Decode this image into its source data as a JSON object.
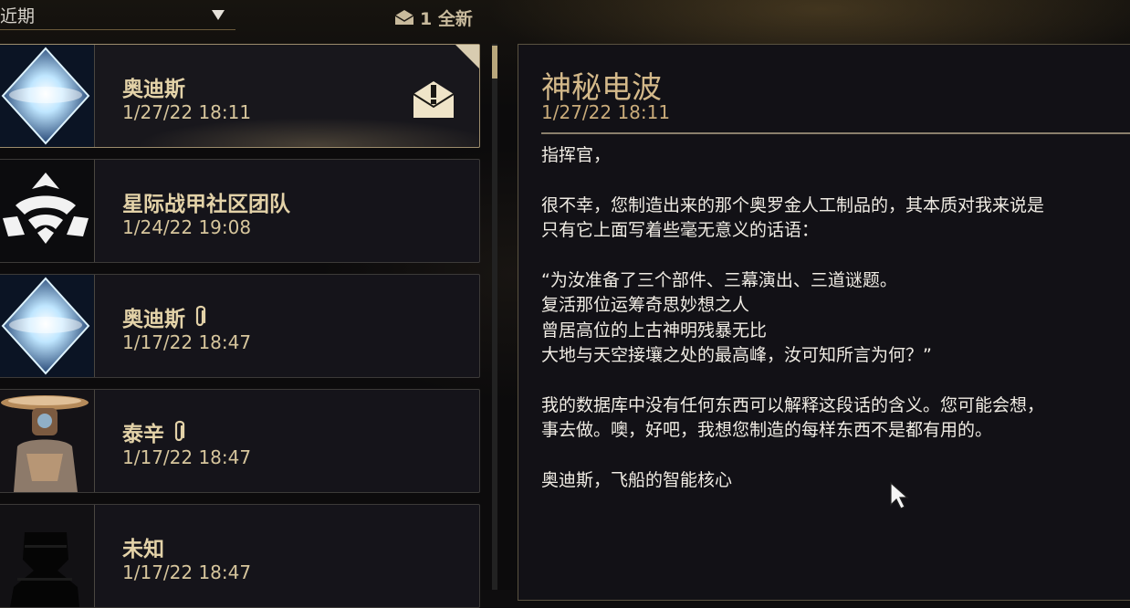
{
  "filter": {
    "label": "近期"
  },
  "new_count": {
    "text": "1 全新"
  },
  "messages": [
    {
      "sender": "奥迪斯",
      "date": "1/27/22 18:11",
      "attachment": false,
      "unread": true,
      "selected": true,
      "avatar": "ordis-diamond"
    },
    {
      "sender": "星际战甲社区团队",
      "date": "1/24/22 19:08",
      "attachment": false,
      "unread": false,
      "selected": false,
      "avatar": "lotus-emblem"
    },
    {
      "sender": "奥迪斯",
      "date": "1/17/22 18:47",
      "attachment": true,
      "unread": false,
      "selected": false,
      "avatar": "ordis-diamond"
    },
    {
      "sender": "泰辛",
      "date": "1/17/22 18:47",
      "attachment": true,
      "unread": false,
      "selected": false,
      "avatar": "teshin-portrait"
    },
    {
      "sender": "未知",
      "date": "1/17/22 18:47",
      "attachment": false,
      "unread": false,
      "selected": false,
      "avatar": "unknown-silhouette"
    }
  ],
  "reader": {
    "subject": "神秘电波",
    "date": "1/27/22 18:11",
    "body": "指挥官，\n\n很不幸，您制造出来的那个奥罗金人工制品的，其本质对我来说是\n只有它上面写着些毫无意义的话语：\n\n“为汝准备了三个部件、三幕演出、三道谜题。\n复活那位运筹奇思妙想之人\n曾居高位的上古神明残暴无比\n大地与天空接壤之处的最高峰，汝可知所言为何？”\n\n我的数据库中没有任何东西可以解释这段话的含义。您可能会想，\n事去做。噢，好吧，我想您制造的每样东西不是都有用的。\n\n奥迪斯，飞船的智能核心"
  },
  "colors": {
    "accent_gold": "#d4b98a",
    "sender_gold": "#e3d2a8",
    "border": "#3c3a38"
  }
}
